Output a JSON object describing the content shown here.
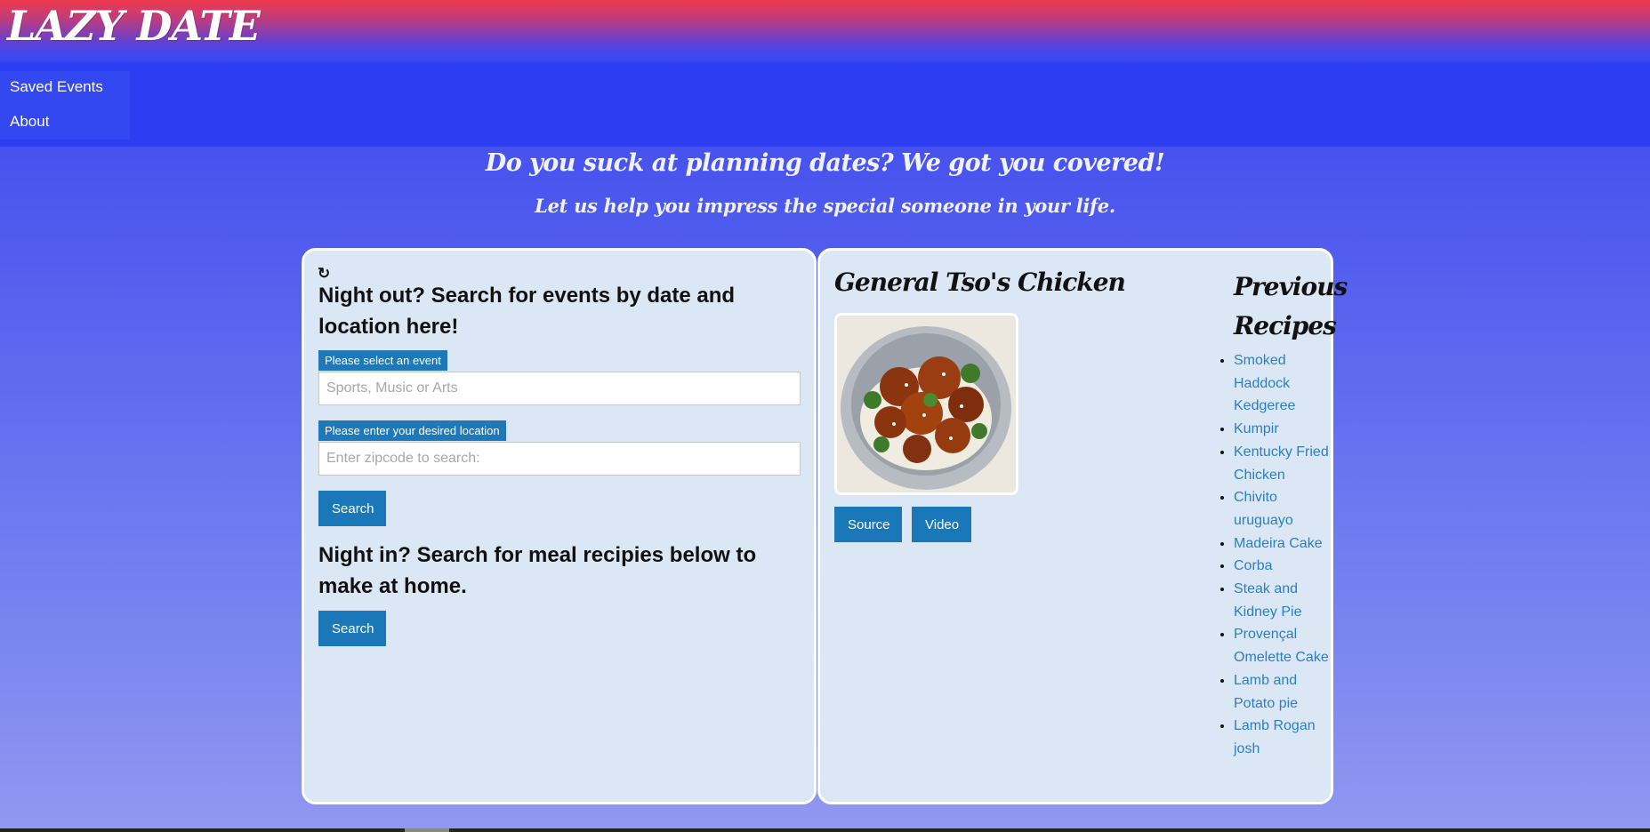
{
  "app": {
    "logo": "LAZY DATE"
  },
  "nav": {
    "items": [
      {
        "label": "Saved Events"
      },
      {
        "label": "About"
      }
    ]
  },
  "hero": {
    "headline": "Do you suck at planning dates? We got you covered!",
    "subheadline": "Let us help you impress the special someone in your life."
  },
  "events": {
    "refresh_icon": "refresh-icon",
    "title": "Night out? Search for events by date and location here!",
    "event_label": "Please select an event",
    "event_placeholder": "Sports, Music or Arts",
    "location_label": "Please enter your desired location",
    "location_placeholder": "Enter zipcode to search:",
    "search_label": "Search"
  },
  "meals": {
    "title": "Night in? Search for meal recipies below to make at home.",
    "search_label": "Search"
  },
  "recipe": {
    "title": "General Tso's Chicken",
    "image_alt": "General Tso's Chicken",
    "source_label": "Source",
    "video_label": "Video"
  },
  "previous": {
    "title": "Previous Recipes",
    "items": [
      "Smoked Haddock Kedgeree",
      "Kumpir",
      "Kentucky Fried Chicken",
      "Chivito uruguayo",
      "Madeira Cake",
      "Corba",
      "Steak and Kidney Pie",
      "Provençal Omelette Cake",
      "Lamb and Potato pie",
      "Lamb Rogan josh"
    ]
  },
  "colors": {
    "accent_button": "#1a78b9",
    "nav_band": "#2d3ef0",
    "panel_bg": "#dce7f6",
    "link": "#2a7fc1"
  }
}
